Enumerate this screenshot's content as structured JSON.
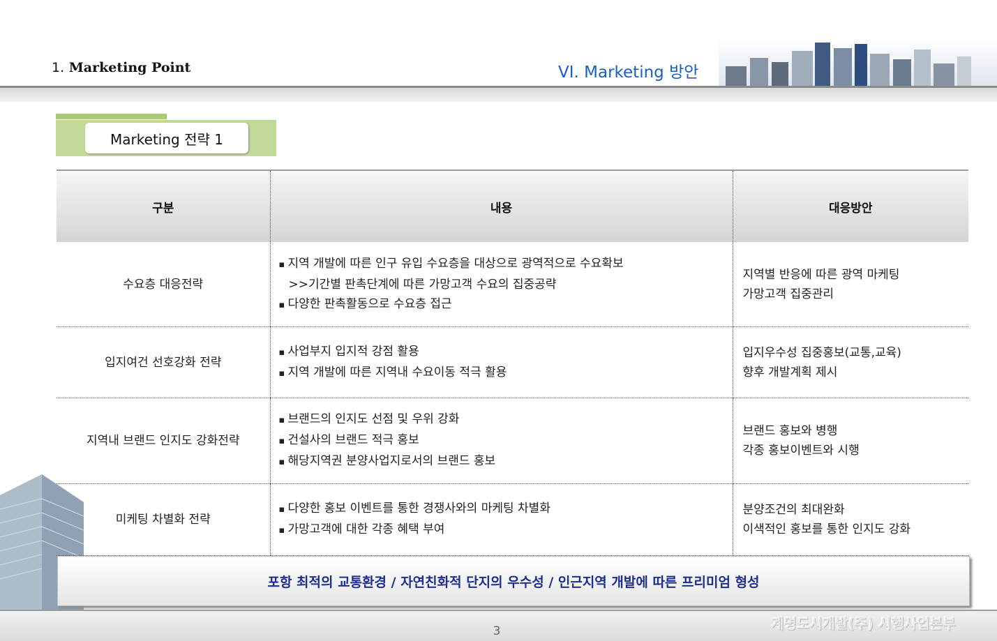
{
  "header": {
    "section_number": "1.",
    "section_title": "Marketing Point",
    "chapter": "VI. Marketing 방안"
  },
  "tag": {
    "label": "Marketing 전략 1"
  },
  "table": {
    "columns": [
      "구분",
      "내용",
      "대응방안"
    ],
    "rows": [
      {
        "category": "수요층 대응전략",
        "content": [
          "지역 개발에 따른 인구 유입 수요층을 대상으로 광역적으로 수요확보",
          ">>기간별 판촉단계에 따른 가망고객 수요의 집중공략",
          "다양한 판촉활동으로 수요층 접근"
        ],
        "response": [
          "지역별 반응에 따른 광역 마케팅",
          "가망고객 집중관리"
        ]
      },
      {
        "category": "입지여건 선호강화 전략",
        "content": [
          "사업부지 입지적 강점 활용",
          "지역 개발에 따른 지역내 수요이동 적극 활용"
        ],
        "response": [
          "입지우수성 집중홍보(교통,교육)",
          "향후 개발계획 제시"
        ]
      },
      {
        "category": "지역내 브랜드 인지도 강화전략",
        "content": [
          "브랜드의 인지도 선점 및 우위 강화",
          "건설사의 브랜드 적극 홍보",
          "해당지역권 분양사업지로서의 브랜드 홍보"
        ],
        "response": [
          "브랜드 홍보와 병행",
          "각종 홍보이벤트와 시행"
        ]
      },
      {
        "category": "미케팅 차별화 전략",
        "content": [
          "다양한 홍보 이벤트를 통한 경쟁사와의 마케팅 차별화",
          "가망고객에 대한 각종 혜택 부여"
        ],
        "response": [
          "분양조건의 최대완화",
          "이색적인 홍보를 통한 인지도 강화"
        ]
      }
    ]
  },
  "summary": "포항 최적의 교통환경 / 자연친화적 단지의 우수성 / 인근지역 개발에 따른 프리미엄 형성",
  "footer": {
    "page_number": "3",
    "company": "계명도시개발(주) 시행사업본부"
  },
  "colors": {
    "accent_blue": "#1a5fc4",
    "tag_green": "#c3d99a",
    "summary_text": "#1c2f8f"
  }
}
